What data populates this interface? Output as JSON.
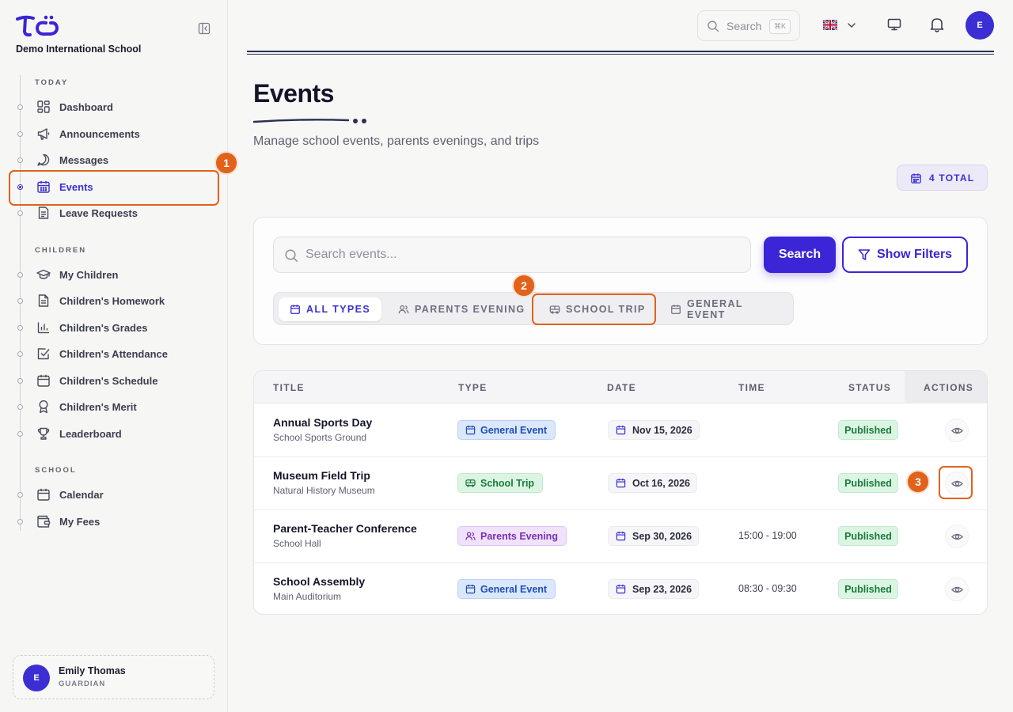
{
  "school": {
    "name": "Demo International School"
  },
  "topbar": {
    "search_label": "Search",
    "shortcut": "⌘K",
    "language_flag": "uk-flag-icon",
    "avatar_initial": "E"
  },
  "sidebar": {
    "sections": [
      {
        "label": "TODAY",
        "items": [
          {
            "label": "Dashboard",
            "icon": "dashboard-icon"
          },
          {
            "label": "Announcements",
            "icon": "megaphone-icon"
          },
          {
            "label": "Messages",
            "icon": "message-icon"
          },
          {
            "label": "Events",
            "icon": "calendar-icon",
            "active": true
          },
          {
            "label": "Leave Requests",
            "icon": "document-icon"
          }
        ]
      },
      {
        "label": "CHILDREN",
        "items": [
          {
            "label": "My Children",
            "icon": "graduation-cap-icon"
          },
          {
            "label": "Children's Homework",
            "icon": "file-text-icon"
          },
          {
            "label": "Children's Grades",
            "icon": "bar-chart-icon"
          },
          {
            "label": "Children's Attendance",
            "icon": "checkbox-icon"
          },
          {
            "label": "Children's Schedule",
            "icon": "calendar-icon"
          },
          {
            "label": "Children's Merit",
            "icon": "award-icon"
          },
          {
            "label": "Leaderboard",
            "icon": "trophy-icon"
          }
        ]
      },
      {
        "label": "SCHOOL",
        "items": [
          {
            "label": "Calendar",
            "icon": "calendar-icon"
          },
          {
            "label": "My Fees",
            "icon": "wallet-icon"
          }
        ]
      }
    ]
  },
  "user": {
    "initial": "E",
    "name": "Emily Thomas",
    "role": "GUARDIAN"
  },
  "page": {
    "title": "Events",
    "subtitle": "Manage school events, parents evenings, and trips",
    "total_badge": "4 TOTAL"
  },
  "filters": {
    "search_placeholder": "Search events...",
    "search_button": "Search",
    "show_filters_button": "Show Filters",
    "type_tabs": [
      {
        "label": "ALL TYPES",
        "icon": "calendar-icon",
        "active": true
      },
      {
        "label": "PARENTS EVENING",
        "icon": "users-icon"
      },
      {
        "label": "SCHOOL TRIP",
        "icon": "bus-icon"
      },
      {
        "label": "GENERAL EVENT",
        "icon": "calendar-icon"
      }
    ]
  },
  "table": {
    "columns": [
      "TITLE",
      "TYPE",
      "DATE",
      "TIME",
      "STATUS",
      "ACTIONS"
    ],
    "rows": [
      {
        "title": "Annual Sports Day",
        "location": "School Sports Ground",
        "type": "General Event",
        "type_kind": "general",
        "date": "Nov 15, 2026",
        "time": "",
        "status": "Published"
      },
      {
        "title": "Museum Field Trip",
        "location": "Natural History Museum",
        "type": "School Trip",
        "type_kind": "trip",
        "date": "Oct 16, 2026",
        "time": "",
        "status": "Published"
      },
      {
        "title": "Parent-Teacher Conference",
        "location": "School Hall",
        "type": "Parents Evening",
        "type_kind": "parents",
        "date": "Sep 30, 2026",
        "time": "15:00 - 19:00",
        "status": "Published"
      },
      {
        "title": "School Assembly",
        "location": "Main Auditorium",
        "type": "General Event",
        "type_kind": "general",
        "date": "Sep 23, 2026",
        "time": "08:30 - 09:30",
        "status": "Published"
      }
    ]
  },
  "annotations": [
    "1",
    "2",
    "3"
  ],
  "colors": {
    "accent": "#3b25d6",
    "highlight": "#e0621b",
    "published": "#1a7a3c"
  }
}
